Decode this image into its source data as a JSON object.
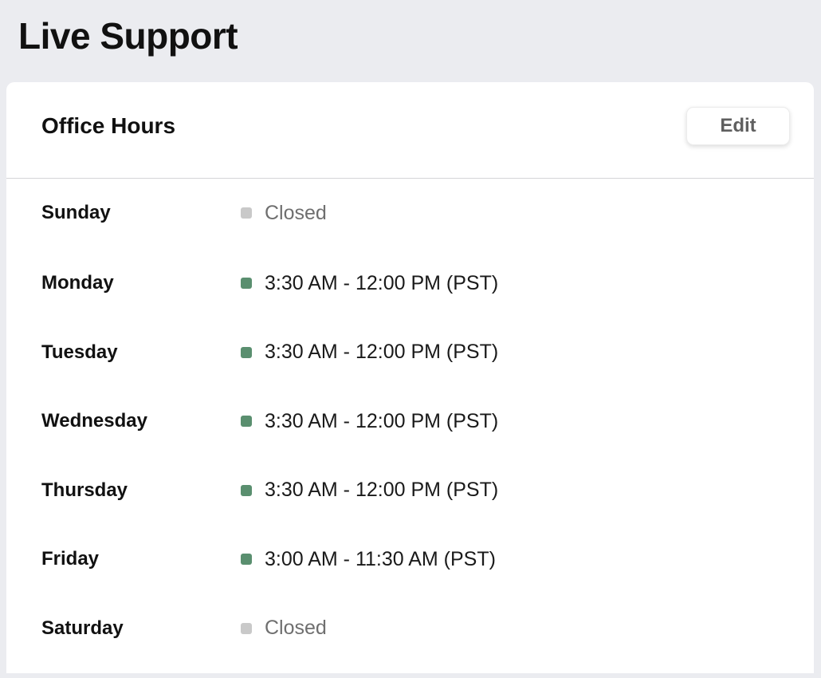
{
  "page": {
    "title": "Live Support"
  },
  "card": {
    "title": "Office Hours",
    "edit_label": "Edit"
  },
  "colors": {
    "open": "#5a8f6f",
    "closed": "#c9c9c9"
  },
  "hours": [
    {
      "day": "Sunday",
      "status": "closed",
      "text": "Closed"
    },
    {
      "day": "Monday",
      "status": "open",
      "text": "3:30 AM - 12:00 PM (PST)"
    },
    {
      "day": "Tuesday",
      "status": "open",
      "text": "3:30 AM - 12:00 PM (PST)"
    },
    {
      "day": "Wednesday",
      "status": "open",
      "text": "3:30 AM - 12:00 PM (PST)"
    },
    {
      "day": "Thursday",
      "status": "open",
      "text": "3:30 AM - 12:00 PM (PST)"
    },
    {
      "day": "Friday",
      "status": "open",
      "text": "3:00 AM - 11:30 AM (PST)"
    },
    {
      "day": "Saturday",
      "status": "closed",
      "text": "Closed"
    }
  ]
}
